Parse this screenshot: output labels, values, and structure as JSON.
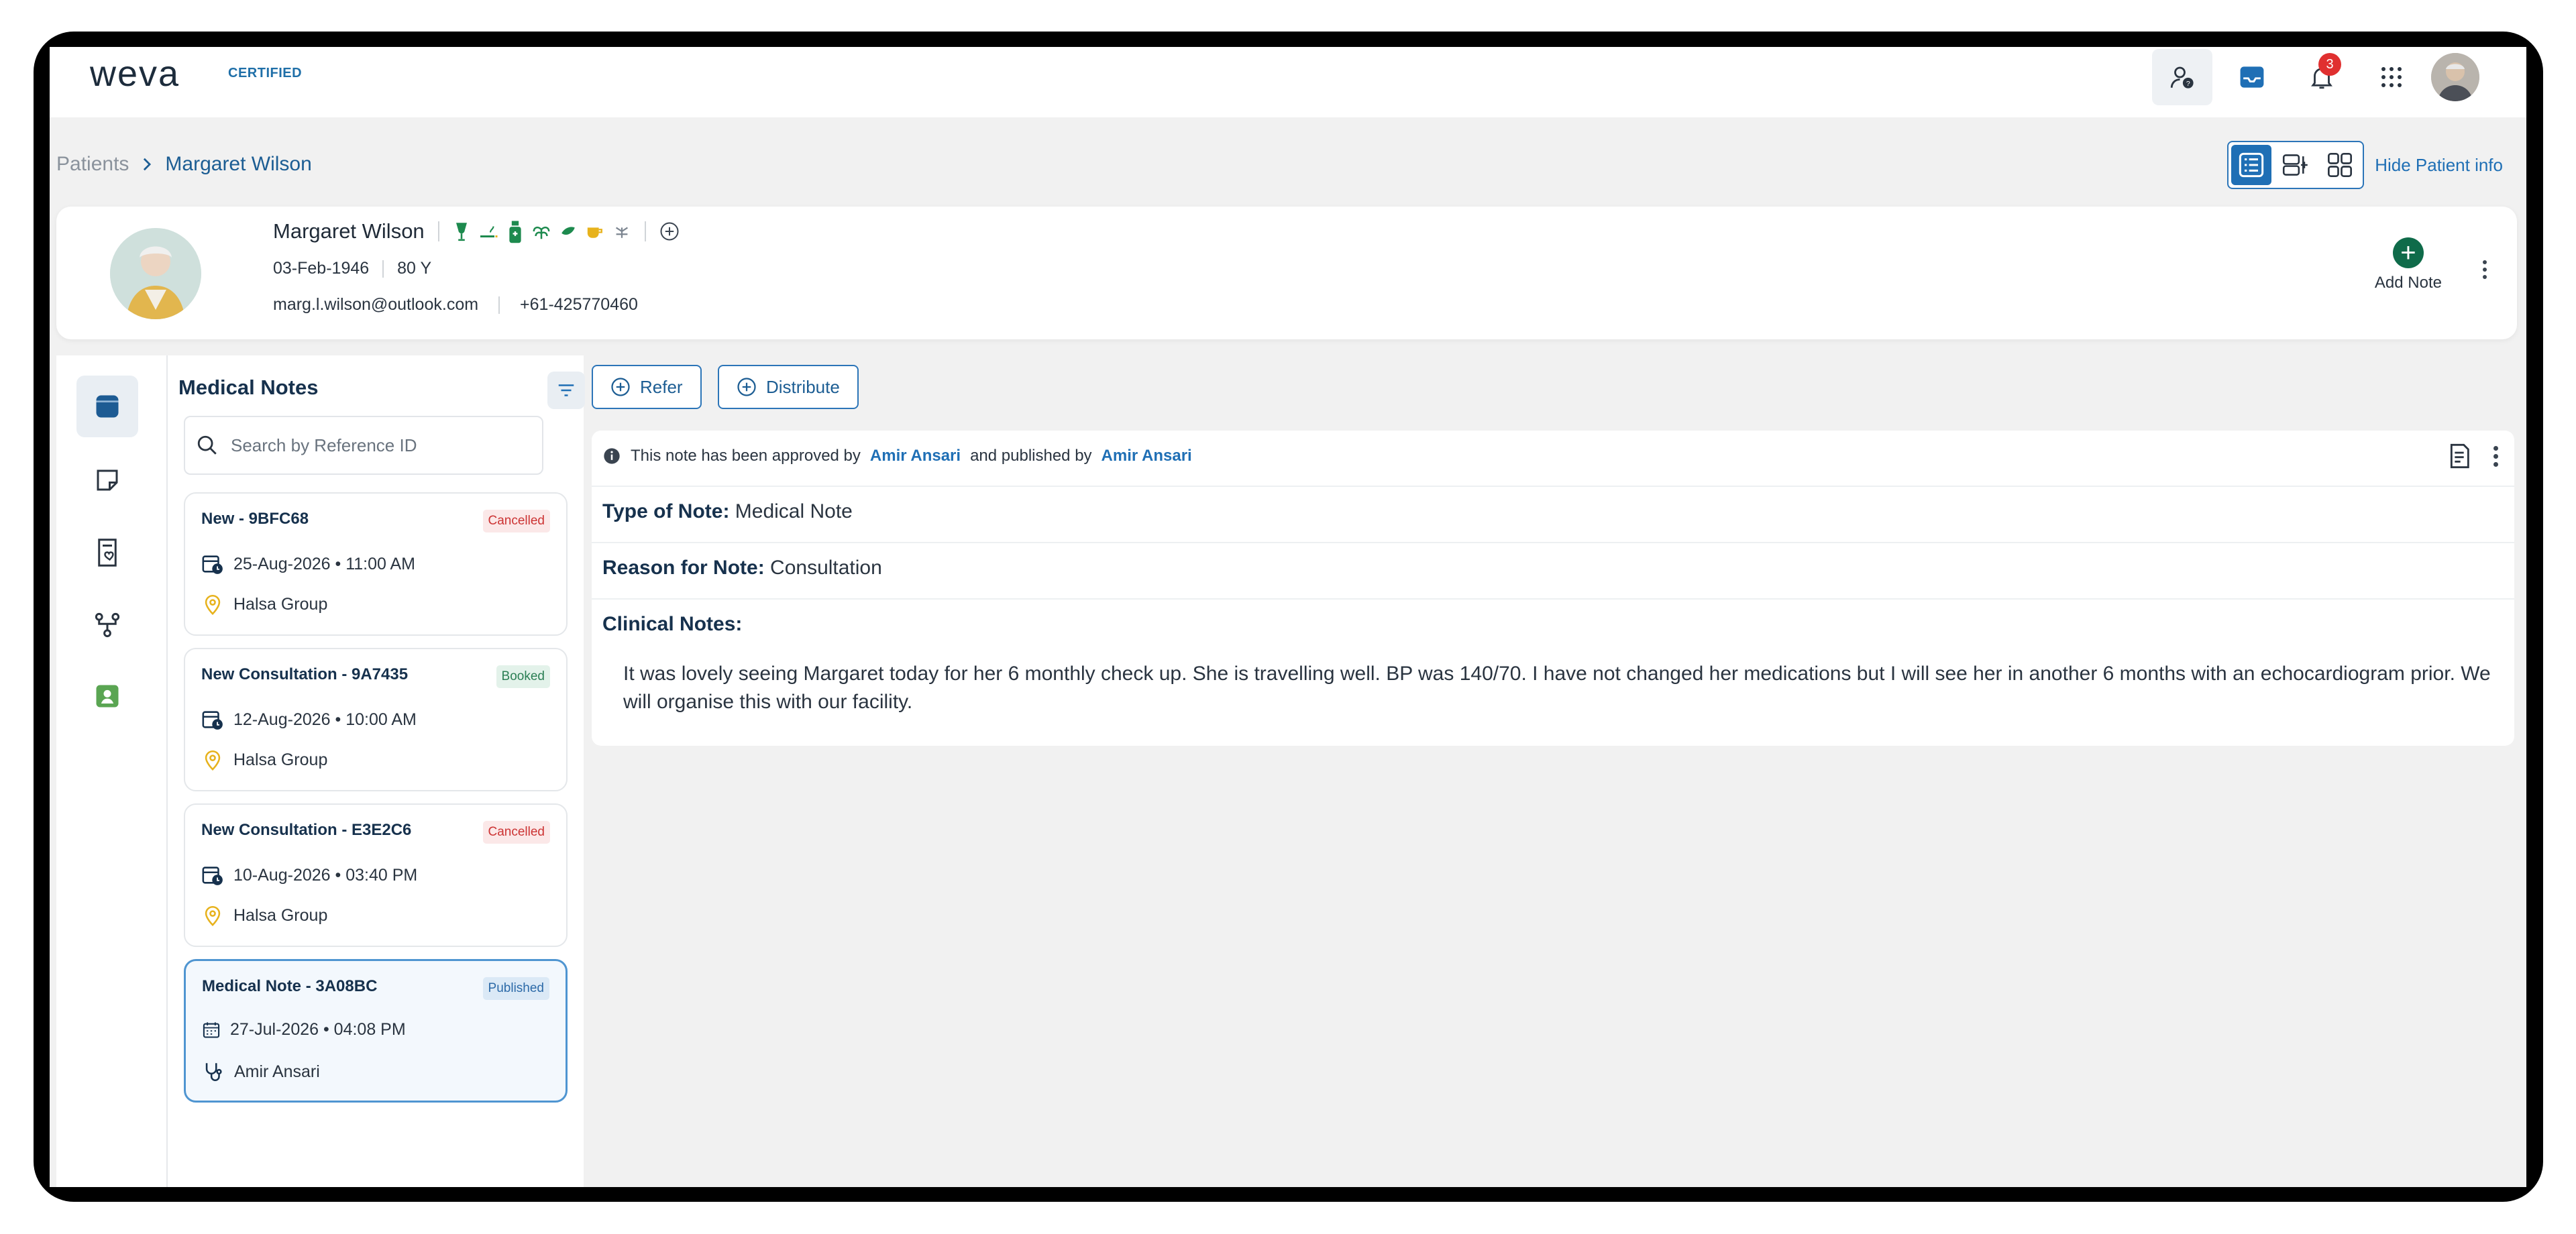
{
  "app": {
    "logo_text": "weva",
    "logo_badge": "CERTIFIED",
    "notifications_count": "3"
  },
  "breadcrumb": {
    "root": "Patients",
    "current": "Margaret Wilson"
  },
  "view": {
    "hide_patient_info": "Hide Patient info"
  },
  "patient": {
    "name": "Margaret Wilson",
    "dob": "03-Feb-1946",
    "age": "80 Y",
    "email": "marg.l.wilson@outlook.com",
    "phone": "+61-425770460",
    "add_note_label": "Add Note"
  },
  "notes_panel": {
    "title": "Medical Notes",
    "search_placeholder": "Search by Reference ID",
    "items": [
      {
        "title": "New - 9BFC68",
        "status": "Cancelled",
        "datetime": "25-Aug-2026 • 11:00 AM",
        "location": "Halsa Group"
      },
      {
        "title": "New Consultation - 9A7435",
        "status": "Booked",
        "datetime": "12-Aug-2026 • 10:00 AM",
        "location": "Halsa Group"
      },
      {
        "title": "New Consultation - E3E2C6",
        "status": "Cancelled",
        "datetime": "10-Aug-2026 • 03:40 PM",
        "location": "Halsa Group"
      },
      {
        "title": "Medical Note - 3A08BC",
        "status": "Published",
        "datetime": "27-Jul-2026 • 04:08 PM",
        "practitioner": "Amir Ansari"
      }
    ]
  },
  "actions": {
    "refer": "Refer",
    "distribute": "Distribute"
  },
  "note_detail": {
    "approval_prefix": "This note has been approved by",
    "approver": "Amir Ansari",
    "approval_middle": "and published by",
    "publisher": "Amir Ansari",
    "type_label": "Type of Note:",
    "type_value": "Medical Note",
    "reason_label": "Reason for Note:",
    "reason_value": "Consultation",
    "clinical_label": "Clinical Notes:",
    "clinical_text": "It was lovely seeing Margaret today for her 6 monthly check up. She is travelling well. BP was 140/70. I have not changed her medications but I will see her in another 6 months with an echocardiogram prior. We will organise this with our facility."
  },
  "colors": {
    "brand_blue": "#1f6fb5",
    "navy": "#16314d",
    "green": "#0f6b4a",
    "cancel_red": "#cc3333",
    "booked_green": "#2b7f54"
  },
  "icons": [
    "help-icon",
    "inbox-icon",
    "bell-icon",
    "apps-grid-icon",
    "user-avatar",
    "list-view-icon",
    "split-view-icon",
    "grid-view-icon",
    "plus-icon",
    "kebab-icon",
    "notes-icon",
    "sticky-note-icon",
    "doc-heart-icon",
    "referral-icon",
    "id-badge-icon",
    "filter-icon",
    "search-icon",
    "calendar-clock-icon",
    "location-pin-icon",
    "calendar-icon",
    "stethoscope-icon",
    "info-icon",
    "document-icon"
  ]
}
